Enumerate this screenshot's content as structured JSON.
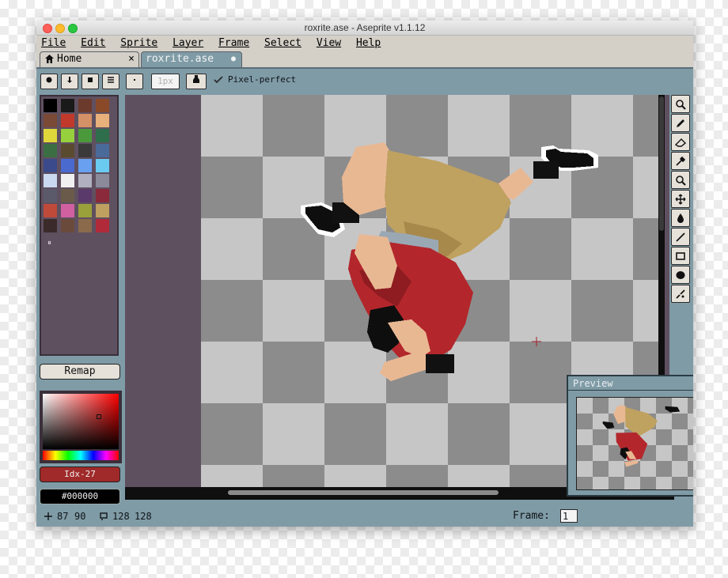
{
  "window": {
    "title": "roxrite.ase - Aseprite v1.1.12"
  },
  "menu": [
    "File",
    "Edit",
    "Sprite",
    "Layer",
    "Frame",
    "Select",
    "View",
    "Help"
  ],
  "tabs": [
    {
      "label": "Home",
      "close": "×"
    },
    {
      "label": "roxrite.ase",
      "modified_dot": "●"
    }
  ],
  "context_bar": {
    "brush_size_label": "1px",
    "pixel_perfect_label": "Pixel-perfect",
    "pixel_perfect_checked": true
  },
  "palette": {
    "colors": [
      "#000000",
      "#1a1a1a",
      "#6b3a2c",
      "#8a4a2a",
      "#7a4a36",
      "#c0392b",
      "#d49066",
      "#e8b07a",
      "#e0d83a",
      "#96d03c",
      "#4a9a3c",
      "#2e6e4c",
      "#3c6e44",
      "#5a4a30",
      "#3a3a3a",
      "#4a6a9a",
      "#3a4a8a",
      "#4a6ad0",
      "#6aa0f0",
      "#6acaf0",
      "#cad8f0",
      "#f0f0f0",
      "#b0b0c0",
      "#8a8a9a",
      "#5a5a6a",
      "#6a5a4a",
      "#5a3a6a",
      "#8a2a3a",
      "#c04a3a",
      "#d060a0",
      "#9aa03a",
      "#c0a060",
      "#3a2a2a",
      "#6a4a3a",
      "#8a6a4a",
      "#b02a3a"
    ],
    "remap_label": "Remap",
    "fg_color_label": "Idx-27",
    "fg_color": "#a02a2a",
    "bg_color_label": "#000000"
  },
  "preview": {
    "title": "Preview"
  },
  "status": {
    "cursor_x": "87",
    "cursor_y": "90",
    "sprite_w": "128",
    "sprite_h": "128",
    "frame_label": "Frame:",
    "frame_value": "1"
  },
  "icons": {
    "tools": [
      "marquee-icon",
      "pencil-icon",
      "eraser-icon",
      "eyedropper-icon",
      "zoom-icon",
      "move-icon",
      "bucket-icon",
      "line-icon",
      "rectangle-icon",
      "ellipse-icon",
      "blur-icon"
    ]
  }
}
